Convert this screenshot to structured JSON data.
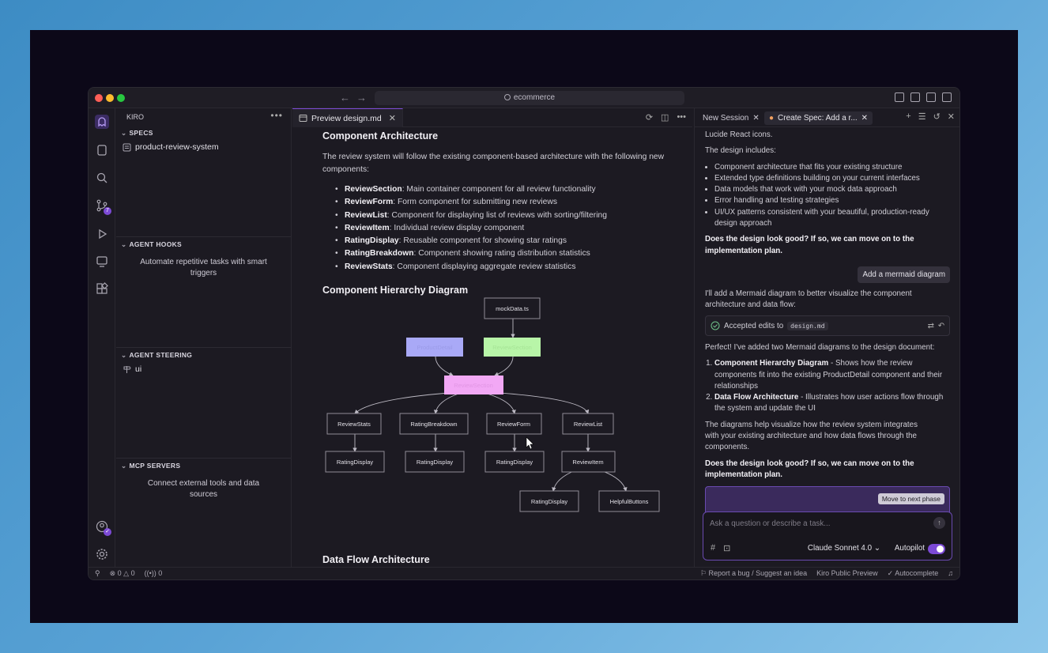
{
  "titlebar": {
    "search_text": "ecommerce"
  },
  "explorer": {
    "title": "KIRO",
    "specs": {
      "title": "SPECS",
      "items": [
        "product-review-system"
      ]
    },
    "hooks": {
      "title": "AGENT HOOKS",
      "description": "Automate repetitive tasks with smart triggers"
    },
    "steering": {
      "title": "AGENT STEERING",
      "items": [
        "ui"
      ]
    },
    "mcp": {
      "title": "MCP SERVERS",
      "description": "Connect external tools and data sources"
    }
  },
  "editor": {
    "tab_label": "Preview design.md",
    "h_component_architecture": "Component Architecture",
    "intro": "The review system will follow the existing component-based architecture with the following new components:",
    "components": [
      {
        "name": "ReviewSection",
        "desc": ": Main container component for all review functionality"
      },
      {
        "name": "ReviewForm",
        "desc": ": Form component for submitting new reviews"
      },
      {
        "name": "ReviewList",
        "desc": ": Component for displaying list of reviews with sorting/filtering"
      },
      {
        "name": "ReviewItem",
        "desc": ": Individual review display component"
      },
      {
        "name": "RatingDisplay",
        "desc": ": Reusable component for showing star ratings"
      },
      {
        "name": "RatingBreakdown",
        "desc": ": Component showing rating distribution statistics"
      },
      {
        "name": "ReviewStats",
        "desc": ": Component displaying aggregate review statistics"
      }
    ],
    "h_hierarchy": "Component Hierarchy Diagram",
    "h_dataflow": "Data Flow Architecture",
    "diagram": {
      "nodes": {
        "mockdata": "mockData.ts",
        "productdetail": "ProductDetail",
        "reviewsection_top": "ReviewSection",
        "reviewsection": "ReviewSection",
        "stats": "ReviewStats",
        "breakdown": "RatingBreakdown",
        "form": "ReviewForm",
        "list": "ReviewList",
        "rd1": "RatingDisplay",
        "rd2": "RatingDisplay",
        "rd3": "RatingDisplay",
        "item": "ReviewItem",
        "rd4": "RatingDisplay",
        "helpful": "HelpfulButtons"
      }
    }
  },
  "chat": {
    "tabs": [
      "New Session",
      "Create Spec: Add a r..."
    ],
    "line_icons": "Lucide React icons.",
    "design_includes": "The design includes:",
    "bullets": [
      "Component architecture that fits your existing structure",
      "Extended type definitions building on your current interfaces",
      "Data models that work with your mock data approach",
      "Error handling and testing strategies",
      "UI/UX patterns consistent with your beautiful, production-ready design approach"
    ],
    "question": "Does the design look good? If so, we can move on to the implementation plan.",
    "user_message": "Add a mermaid diagram",
    "reply_intro": "I'll add a Mermaid diagram to better visualize the component architecture and data flow:",
    "accepted_label": "Accepted edits to",
    "accepted_file": "design.md",
    "perfect": "Perfect! I've added two Mermaid diagrams to the design document:",
    "numbered": [
      {
        "title": "Component Hierarchy Diagram",
        "desc": " - Shows how the review components fit into the existing ProductDetail component and their relationships"
      },
      {
        "title": "Data Flow Architecture",
        "desc": " - Illustrates how user actions flow through the system and update the UI"
      }
    ],
    "diagrams_help": "The diagrams help visualize how the review system integrates with your existing architecture and how data flows through the components.",
    "question2": "Does the design look good? If so, we can move on to the implementation plan.",
    "phase_button": "Move to next phase",
    "input_placeholder": "Ask a question or describe a task...",
    "model": "Claude Sonnet 4.0",
    "autopilot": "Autopilot"
  },
  "status": {
    "errors": "0",
    "warnings": "0",
    "ports": "0",
    "report": "Report a bug / Suggest an idea",
    "preview": "Kiro Public Preview",
    "autocomplete": "Autocomplete"
  },
  "colors": {
    "accent": "#7c4ad6",
    "node_blue": "#a9a9f7",
    "node_green": "#b8f5a8",
    "node_pink": "#f2a8f5"
  }
}
